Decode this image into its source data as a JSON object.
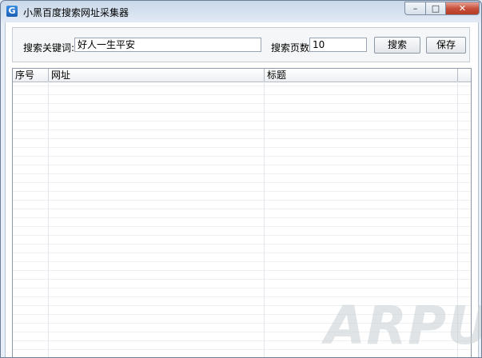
{
  "window": {
    "title": "小黑百度搜索网址采集器",
    "app_icon_letter": "G",
    "controls": {
      "minimize": "–",
      "maximize": "□",
      "close": "✕"
    }
  },
  "search": {
    "keyword_label": "搜索关键词:",
    "keyword_value": "好人一生平安",
    "pages_label": "搜索页数",
    "pages_value": "10",
    "search_button": "搜索",
    "save_button": "保存"
  },
  "results_table": {
    "columns": [
      "序号",
      "网址",
      "标题",
      ""
    ],
    "rows": []
  },
  "watermark": "ARPUN",
  "colors": {
    "close_button": "#c7513c",
    "title_gradient_top": "#c9d8ea"
  }
}
